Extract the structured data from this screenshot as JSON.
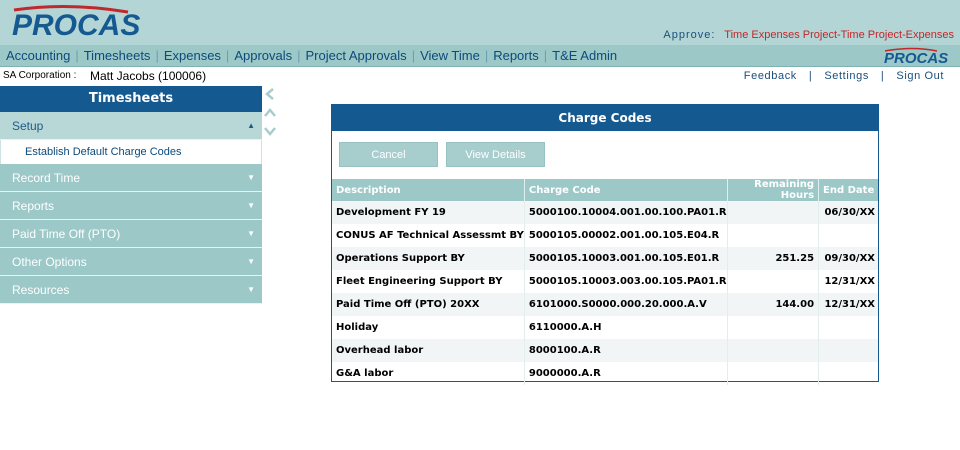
{
  "header": {
    "logo_text": "PROCAS",
    "approve_label": "Approve:",
    "approve_links": [
      "Time",
      "Expenses",
      "Project-Time",
      "Project-Expenses"
    ]
  },
  "nav": {
    "items": [
      "Accounting",
      "Timesheets",
      "Expenses",
      "Approvals",
      "Project Approvals",
      "View Time",
      "Reports",
      "T&E Admin"
    ],
    "logo_text": "PROCAS"
  },
  "user": {
    "corp_label": "SA Corporation :",
    "name": "Matt Jacobs (100006)",
    "links": [
      "Feedback",
      "Settings",
      "Sign Out"
    ]
  },
  "sidebar": {
    "title": "Timesheets",
    "setup_label": "Setup",
    "setup_sub": "Establish Default Charge Codes",
    "items": [
      "Record Time",
      "Reports",
      "Paid Time Off (PTO)",
      "Other Options",
      "Resources"
    ]
  },
  "panel": {
    "title": "Charge Codes",
    "cancel_label": "Cancel",
    "view_details_label": "View Details",
    "columns": [
      "Description",
      "Charge Code",
      "Remaining Hours",
      "End Date"
    ],
    "rows": [
      {
        "description": "Development FY 19",
        "code": "5000100.10004.001.00.100.PA01.R",
        "hours": "",
        "end": "06/30/XX"
      },
      {
        "description": "CONUS AF Technical Assessmt BY",
        "code": "5000105.00002.001.00.105.E04.R",
        "hours": "",
        "end": ""
      },
      {
        "description": "Operations Support BY",
        "code": "5000105.10003.001.00.105.E01.R",
        "hours": "251.25",
        "end": "09/30/XX"
      },
      {
        "description": "Fleet Engineering Support BY",
        "code": "5000105.10003.003.00.105.PA01.R",
        "hours": "",
        "end": "12/31/XX"
      },
      {
        "description": "Paid Time Off (PTO) 20XX",
        "code": "6101000.S0000.000.20.000.A.V",
        "hours": "144.00",
        "end": "12/31/XX"
      },
      {
        "description": "Holiday",
        "code": "6110000.A.H",
        "hours": "",
        "end": ""
      },
      {
        "description": "Overhead labor",
        "code": "8000100.A.R",
        "hours": "",
        "end": ""
      },
      {
        "description": "G&A labor",
        "code": "9000000.A.R",
        "hours": "",
        "end": ""
      }
    ]
  },
  "colors": {
    "brand_blue": "#155991",
    "teal": "#9cc8c8",
    "header_bg": "#b3d5d5",
    "accent_red": "#c0282b"
  }
}
